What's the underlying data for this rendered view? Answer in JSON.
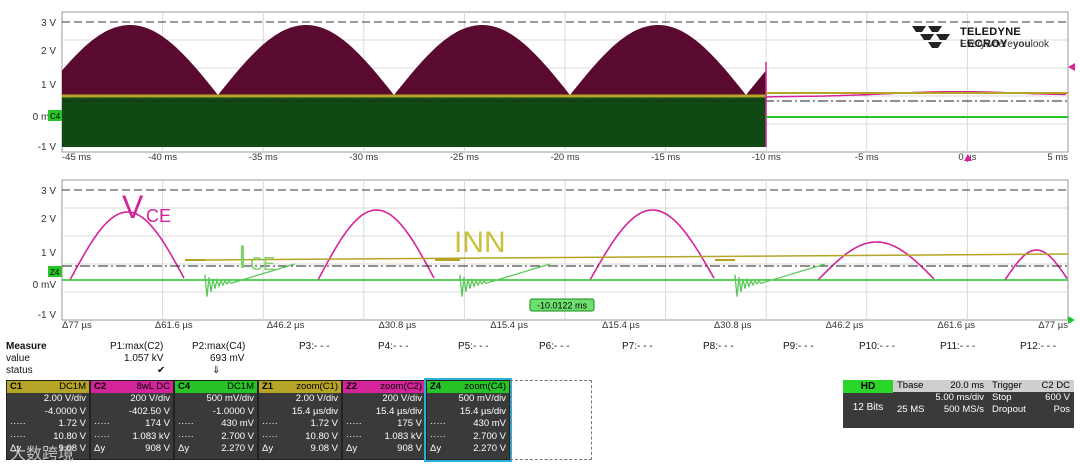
{
  "top_grid": {
    "y_labels": [
      "3 V",
      "2 V",
      "1 V",
      "0 mV",
      "-1 V"
    ],
    "x_labels": [
      "-45 ms",
      "-40 ms",
      "-35 ms",
      "-30 ms",
      "-25 ms",
      "-20 ms",
      "-15 ms",
      "-10 ms",
      "-5 ms",
      "0 µs",
      "5 ms"
    ],
    "channel_tag": "C4"
  },
  "bottom_grid": {
    "y_labels": [
      "3 V",
      "2 V",
      "1 V",
      "0 mV",
      "-1 V"
    ],
    "x_labels": [
      "Δ77 µs",
      "Δ61.6 µs",
      "Δ46.2 µs",
      "Δ30.8 µs",
      "Δ15.4 µs",
      "Δ15.4 µs",
      "Δ30.8 µs",
      "Δ46.2 µs",
      "Δ61.6 µs",
      "Δ77 µs"
    ],
    "channel_tag": "Z4",
    "cursor_readout": "-10.0122 ms",
    "annotations": {
      "vce": "V",
      "vce_sub": "CE",
      "ice": "I",
      "ice_sub": "CE",
      "inn": "INN"
    }
  },
  "logo": {
    "brand": "TELEDYNE LECROY",
    "tagline_a": "Everywhere",
    "tagline_b": "you",
    "tagline_c": "look"
  },
  "measure": {
    "title": "Measure",
    "row_labels": [
      "value",
      "status"
    ],
    "params": [
      "P1:max(C2)",
      "P2:max(C4)",
      "P3:- - -",
      "P4:- - -",
      "P5:- - -",
      "P6:- - -",
      "P7:- - -",
      "P8:- - -",
      "P9:- - -",
      "P10:- - -",
      "P11:- - -",
      "P12:- - -"
    ],
    "values": [
      "1.057 kV",
      "693 mV"
    ],
    "status": [
      "✔",
      "⇓"
    ]
  },
  "channels": [
    {
      "name": "C1",
      "tag": "DC1M",
      "color": "#b5a426",
      "rows": [
        [
          "",
          "2.00 V/div"
        ],
        [
          "",
          "-4.0000 V"
        ],
        [
          "·····",
          "1.72 V"
        ],
        [
          "·····",
          "10.80 V"
        ],
        [
          "Δy",
          "9.08 V"
        ]
      ]
    },
    {
      "name": "C2",
      "tag": "8wL DC",
      "color": "#d4249a",
      "rows": [
        [
          "",
          "200 V/div"
        ],
        [
          "",
          "-402.50 V"
        ],
        [
          "·····",
          "174 V"
        ],
        [
          "·····",
          "1.083 kV"
        ],
        [
          "Δy",
          "908 V"
        ]
      ]
    },
    {
      "name": "C4",
      "tag": "DC1M",
      "color": "#26c426",
      "rows": [
        [
          "",
          "500 mV/div"
        ],
        [
          "",
          "-1.0000 V"
        ],
        [
          "·····",
          "430 mV"
        ],
        [
          "·····",
          "2.700 V"
        ],
        [
          "Δy",
          "2.270 V"
        ]
      ]
    },
    {
      "name": "Z1",
      "tag": "zoom(C1)",
      "color": "#b5a426",
      "rows": [
        [
          "",
          "2.00 V/div"
        ],
        [
          "",
          "15.4 µs/div"
        ],
        [
          "·····",
          "1.72 V"
        ],
        [
          "·····",
          "10.80 V"
        ],
        [
          "Δy",
          "9.08 V"
        ]
      ]
    },
    {
      "name": "Z2",
      "tag": "zoom(C2)",
      "color": "#d4249a",
      "rows": [
        [
          "",
          "200 V/div"
        ],
        [
          "",
          "15.4 µs/div"
        ],
        [
          "·····",
          "175 V"
        ],
        [
          "·····",
          "1.083 kV"
        ],
        [
          "Δy",
          "908 V"
        ]
      ]
    },
    {
      "name": "Z4",
      "tag": "zoom(C4)",
      "color": "#26c426",
      "rows": [
        [
          "",
          "500 mV/div"
        ],
        [
          "",
          "15.4 µs/div"
        ],
        [
          "·····",
          "430 mV"
        ],
        [
          "·····",
          "2.700 V"
        ],
        [
          "Δy",
          "2.270 V"
        ]
      ]
    }
  ],
  "acq": {
    "hd": "HD",
    "bits": "12 Bits"
  },
  "timebase": {
    "title": "Tbase",
    "title_val": "20.0 ms",
    "r1": "5.00 ms/div",
    "r2a": "25 MS",
    "r2b": "500 MS/s"
  },
  "trigger": {
    "title": "Trigger",
    "tags": "C2 DC",
    "r1a": "Stop",
    "r1b": "600 V",
    "r2a": "Dropout",
    "r2b": "Pos"
  },
  "watermark": "大数跨境",
  "colors": {
    "c1": "#b5a426",
    "c2": "#d4249a",
    "c4": "#26c426",
    "c2_fill": "#5a0a2e",
    "c4_fill": "#0f4a12"
  }
}
